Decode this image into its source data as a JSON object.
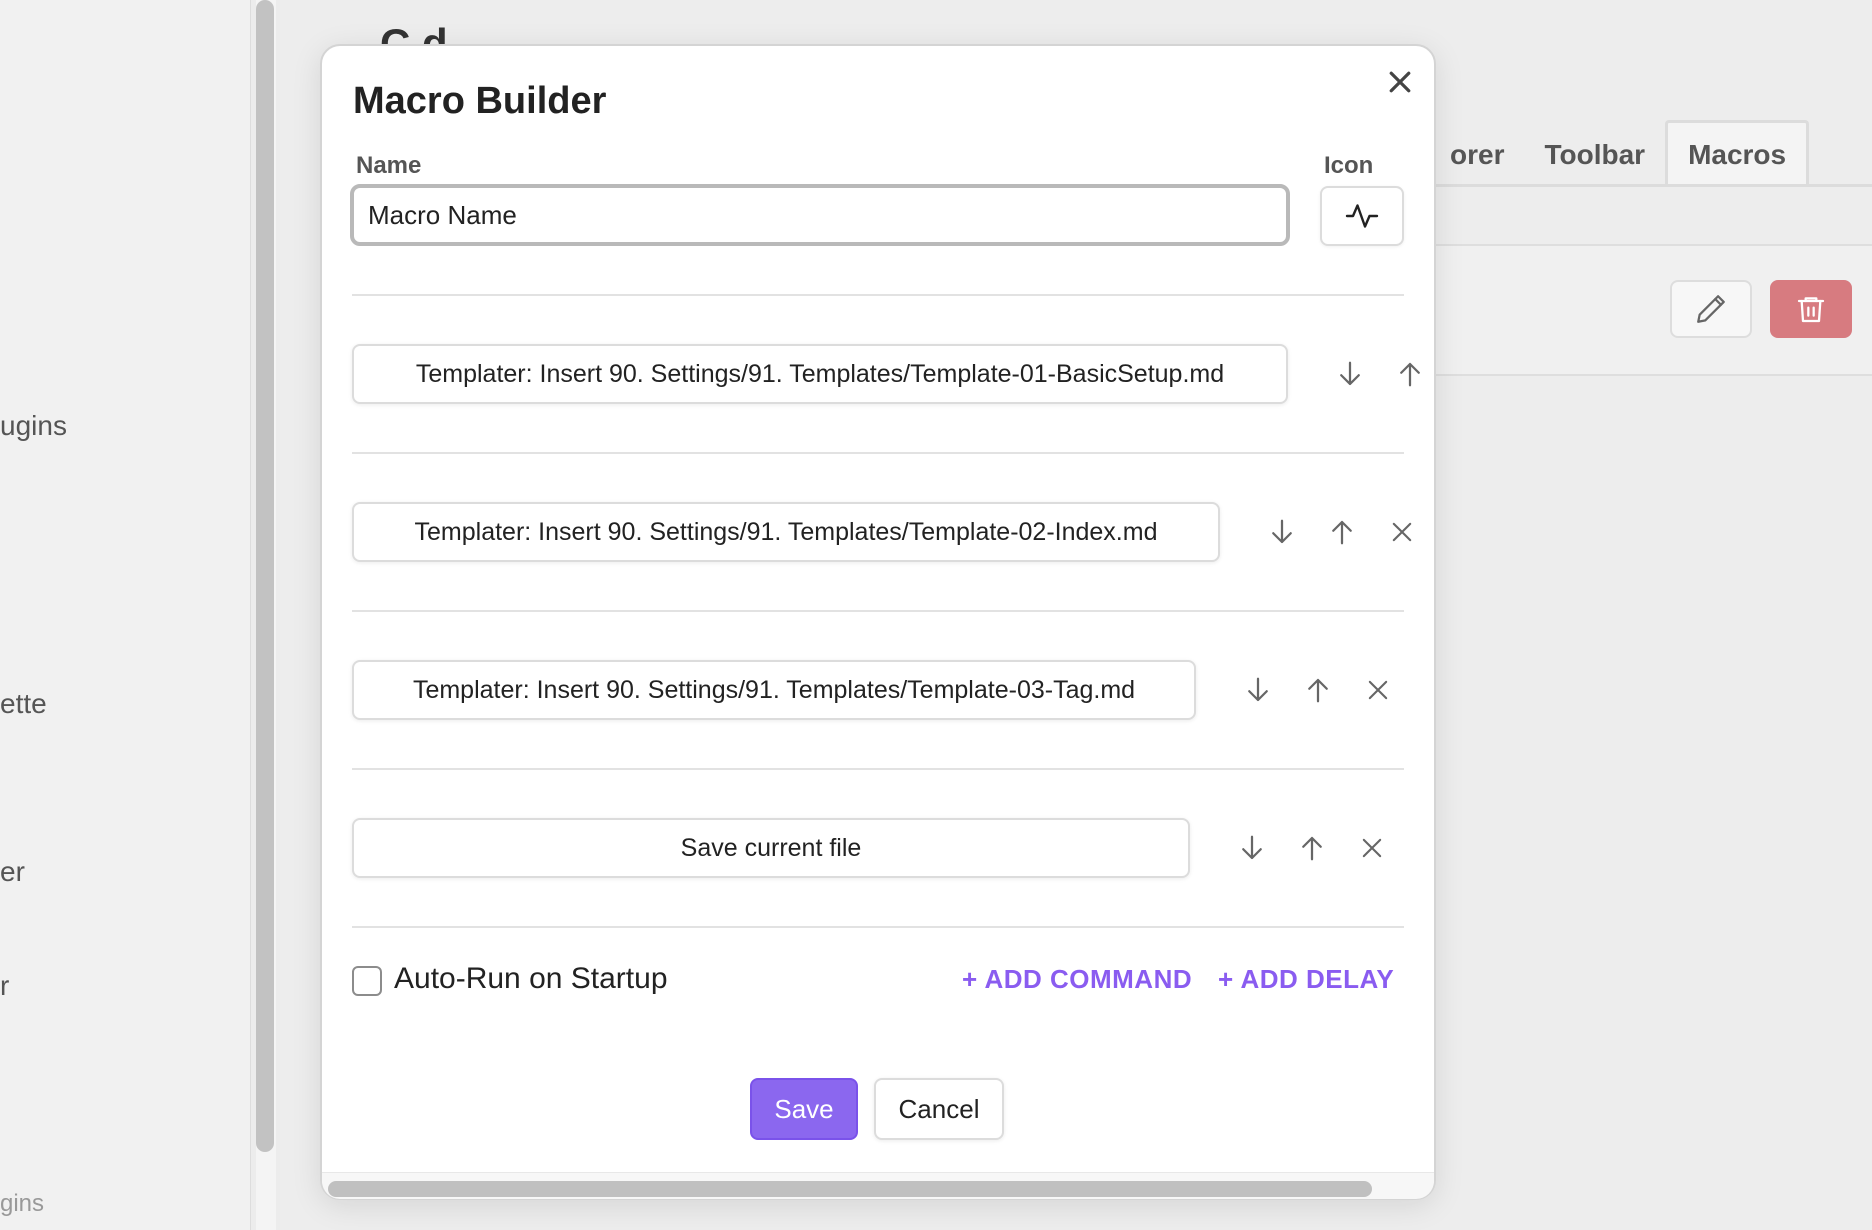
{
  "sidebar": {
    "items": [
      {
        "label": "ugins"
      },
      {
        "label": "ette"
      },
      {
        "label": "er"
      },
      {
        "label": "r"
      },
      {
        "label": "gins"
      }
    ]
  },
  "background": {
    "title": "C             d",
    "tabs": [
      {
        "label": "orer",
        "active": false
      },
      {
        "label": "Toolbar",
        "active": false
      },
      {
        "label": "Macros",
        "active": true
      }
    ],
    "card_actions": {
      "edit_icon": "pencil-icon",
      "delete_icon": "trash-icon"
    }
  },
  "modal": {
    "title": "Macro Builder",
    "name_label": "Name",
    "name_value": "Macro Name",
    "icon_label": "Icon",
    "icon_name": "activity-icon",
    "commands": [
      {
        "label": "Templater: Insert 90. Settings/91. Templates/Template-01-BasicSetup.md",
        "removable": false
      },
      {
        "label": "Templater: Insert 90. Settings/91. Templates/Template-02-Index.md",
        "removable": true
      },
      {
        "label": "Templater: Insert 90. Settings/91. Templates/Template-03-Tag.md",
        "removable": true
      },
      {
        "label": "Save current file",
        "removable": true
      }
    ],
    "auto_run_label": "Auto-Run on Startup",
    "auto_run_checked": false,
    "add_command_label": "+ ADD COMMAND",
    "add_delay_label": "+ ADD DELAY",
    "save_label": "Save",
    "cancel_label": "Cancel"
  },
  "colors": {
    "accent": "#8b67ef",
    "link": "#8a5cf0",
    "danger": "#d77b80"
  }
}
